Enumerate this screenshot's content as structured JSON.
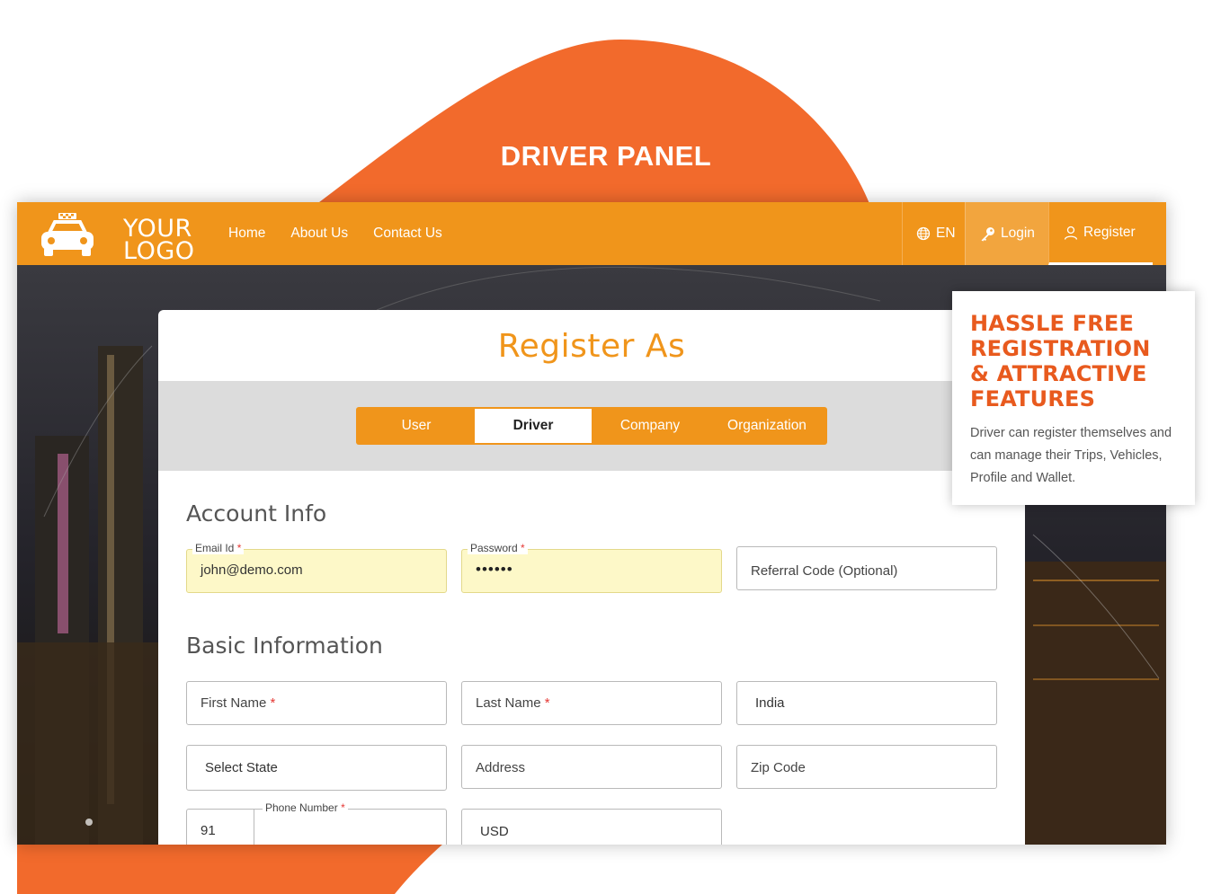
{
  "banner": {
    "title": "DRIVER PANEL"
  },
  "colors": {
    "accent": "#f0951b",
    "banner": "#f2692c",
    "callout_heading": "#e85a1e",
    "filled_field": "#fdf8c8"
  },
  "navbar": {
    "logo": {
      "line1": "YOUR",
      "line2": "LOGO",
      "icon": "taxi-icon"
    },
    "links": [
      "Home",
      "About Us",
      "Contact Us"
    ],
    "language": {
      "label": "EN",
      "icon": "globe-icon"
    },
    "login": {
      "label": "Login",
      "icon": "key-icon"
    },
    "register": {
      "label": "Register",
      "icon": "user-icon"
    }
  },
  "form": {
    "title": "Register As",
    "tabs": [
      "User",
      "Driver",
      "Company",
      "Organization"
    ],
    "active_tab": "Driver",
    "account_info": {
      "title": "Account Info",
      "email": {
        "label": "Email Id",
        "value": "john@demo.com"
      },
      "password": {
        "label": "Password",
        "value": "••••••"
      },
      "referral": {
        "placeholder": "Referral Code (Optional)"
      }
    },
    "basic_info": {
      "title": "Basic Information",
      "first_name": {
        "placeholder": "First Name"
      },
      "last_name": {
        "placeholder": "Last Name"
      },
      "country": {
        "value": "India"
      },
      "state": {
        "value": "Select State"
      },
      "address": {
        "placeholder": "Address"
      },
      "zip": {
        "placeholder": "Zip Code"
      },
      "phone": {
        "label": "Phone Number",
        "code": "91"
      },
      "currency": {
        "value": "USD"
      }
    },
    "required_mark": "*"
  },
  "callout": {
    "heading": "HASSLE FREE REGISTRATION & ATTRACTIVE FEATURES",
    "body": "Driver can register themselves and can manage their Trips, Vehicles, Profile and Wallet."
  }
}
